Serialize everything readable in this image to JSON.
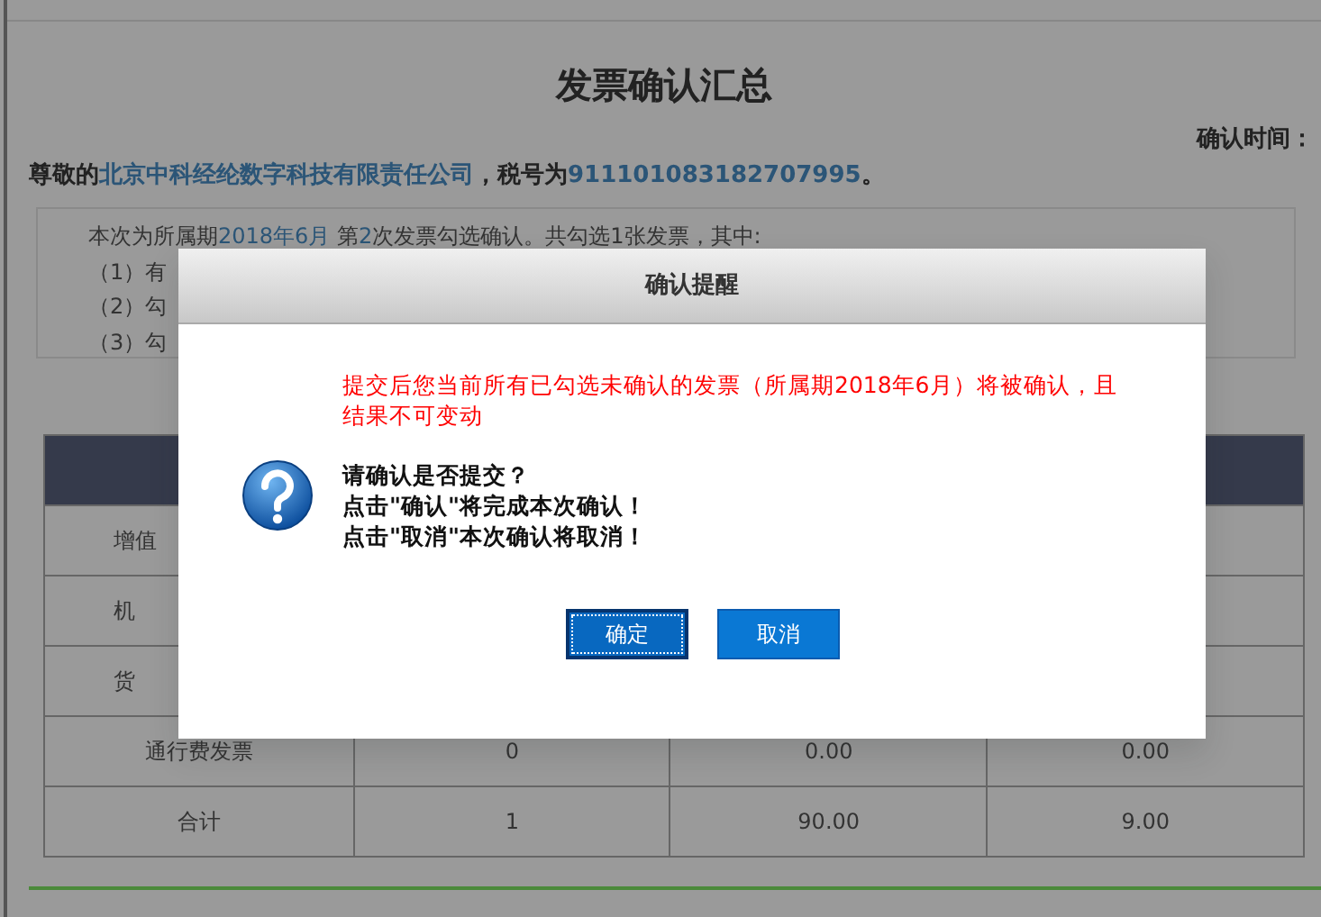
{
  "page": {
    "title": "发票确认汇总",
    "confirm_time_label": "确认时间：",
    "greeting": {
      "prefix": "尊敬的",
      "company": "北京中科经纶数字科技有限责任公司",
      "middle": "，税号为",
      "tax_id": "911101083182707995",
      "suffix": "。"
    },
    "summary": {
      "parts": [
        {
          "kind": "plain",
          "text": "本次为所属期"
        },
        {
          "kind": "link",
          "text": "2018年6月"
        },
        {
          "kind": "plain",
          "text": " 第"
        },
        {
          "kind": "link",
          "text": "2"
        },
        {
          "kind": "plain",
          "text": "次发票勾选确认。共勾选1张发票，其中:"
        }
      ],
      "lines": [
        "（1）有",
        "（2）勾",
        "（3）勾"
      ]
    }
  },
  "table": {
    "rows": [
      {
        "cells": [
          "增值"
        ]
      },
      {
        "cells": [
          "机"
        ]
      },
      {
        "cells": [
          "货"
        ]
      },
      {
        "cells": [
          "通行费发票",
          "0",
          "0.00",
          "0.00"
        ]
      },
      {
        "cells": [
          "合计",
          "1",
          "90.00",
          "9.00"
        ]
      }
    ]
  },
  "dialog": {
    "title": "确认提醒",
    "warning": "提交后您当前所有已勾选未确认的发票（所属期2018年6月）将被确认，且结果不可变动",
    "messages": [
      "请确认是否提交？",
      "点击\"确认\"将完成本次确认！",
      "点击\"取消\"本次确认将取消！"
    ],
    "buttons": [
      {
        "label": "确定",
        "focused": true
      },
      {
        "label": "取消",
        "focused": false
      }
    ]
  }
}
